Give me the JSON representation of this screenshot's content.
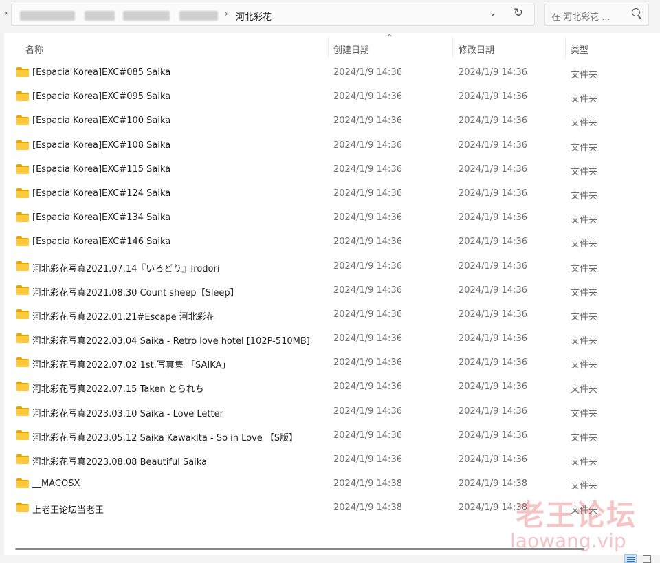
{
  "address_bar": {
    "current_folder": "河北彩花",
    "separator": "›"
  },
  "search": {
    "placeholder": "在 河北彩花 ..."
  },
  "columns": {
    "name": "名称",
    "created": "创建日期",
    "modified": "修改日期",
    "type": "类型"
  },
  "files": [
    {
      "name": "[Espacia Korea]EXC#085 Saika",
      "created": "2024/1/9 14:36",
      "modified": "2024/1/9 14:36",
      "type": "文件夹"
    },
    {
      "name": "[Espacia Korea]EXC#095 Saika",
      "created": "2024/1/9 14:36",
      "modified": "2024/1/9 14:36",
      "type": "文件夹"
    },
    {
      "name": "[Espacia Korea]EXC#100 Saika",
      "created": "2024/1/9 14:36",
      "modified": "2024/1/9 14:36",
      "type": "文件夹"
    },
    {
      "name": "[Espacia Korea]EXC#108 Saika",
      "created": "2024/1/9 14:36",
      "modified": "2024/1/9 14:36",
      "type": "文件夹"
    },
    {
      "name": "[Espacia Korea]EXC#115 Saika",
      "created": "2024/1/9 14:36",
      "modified": "2024/1/9 14:36",
      "type": "文件夹"
    },
    {
      "name": "[Espacia Korea]EXC#124 Saika",
      "created": "2024/1/9 14:36",
      "modified": "2024/1/9 14:36",
      "type": "文件夹"
    },
    {
      "name": "[Espacia Korea]EXC#134 Saika",
      "created": "2024/1/9 14:36",
      "modified": "2024/1/9 14:36",
      "type": "文件夹"
    },
    {
      "name": "[Espacia Korea]EXC#146 Saika",
      "created": "2024/1/9 14:36",
      "modified": "2024/1/9 14:36",
      "type": "文件夹"
    },
    {
      "name": "河北彩花写真2021.07.14『いろどり』Irodori",
      "created": "2024/1/9 14:36",
      "modified": "2024/1/9 14:36",
      "type": "文件夹"
    },
    {
      "name": "河北彩花写真2021.08.30 Count sheep【Sleep】",
      "created": "2024/1/9 14:36",
      "modified": "2024/1/9 14:36",
      "type": "文件夹"
    },
    {
      "name": "河北彩花写真2022.01.21#Escape 河北彩花",
      "created": "2024/1/9 14:36",
      "modified": "2024/1/9 14:36",
      "type": "文件夹"
    },
    {
      "name": "河北彩花写真2022.03.04 Saika - Retro love hotel [102P-510MB]",
      "created": "2024/1/9 14:36",
      "modified": "2024/1/9 14:36",
      "type": "文件夹"
    },
    {
      "name": "河北彩花写真2022.07.02 1st.写真集 「SAIKA」",
      "created": "2024/1/9 14:36",
      "modified": "2024/1/9 14:36",
      "type": "文件夹"
    },
    {
      "name": "河北彩花写真2022.07.15 Taken とられち",
      "created": "2024/1/9 14:36",
      "modified": "2024/1/9 14:36",
      "type": "文件夹"
    },
    {
      "name": "河北彩花写真2023.03.10 Saika - Love Letter",
      "created": "2024/1/9 14:36",
      "modified": "2024/1/9 14:36",
      "type": "文件夹"
    },
    {
      "name": "河北彩花写真2023.05.12 Saika Kawakita  - So in Love 【S版】",
      "created": "2024/1/9 14:36",
      "modified": "2024/1/9 14:36",
      "type": "文件夹"
    },
    {
      "name": "河北彩花写真2023.08.08  Beautiful Saika",
      "created": "2024/1/9 14:36",
      "modified": "2024/1/9 14:36",
      "type": "文件夹"
    },
    {
      "name": "__MACOSX",
      "created": "2024/1/9 14:38",
      "modified": "2024/1/9 14:38",
      "type": "文件夹"
    },
    {
      "name": "上老王论坛当老王",
      "created": "2024/1/9 14:38",
      "modified": "2024/1/9 14:38",
      "type": "文件夹"
    }
  ],
  "watermark": {
    "text_cn": "老王论坛",
    "url": "laowang.vip"
  }
}
